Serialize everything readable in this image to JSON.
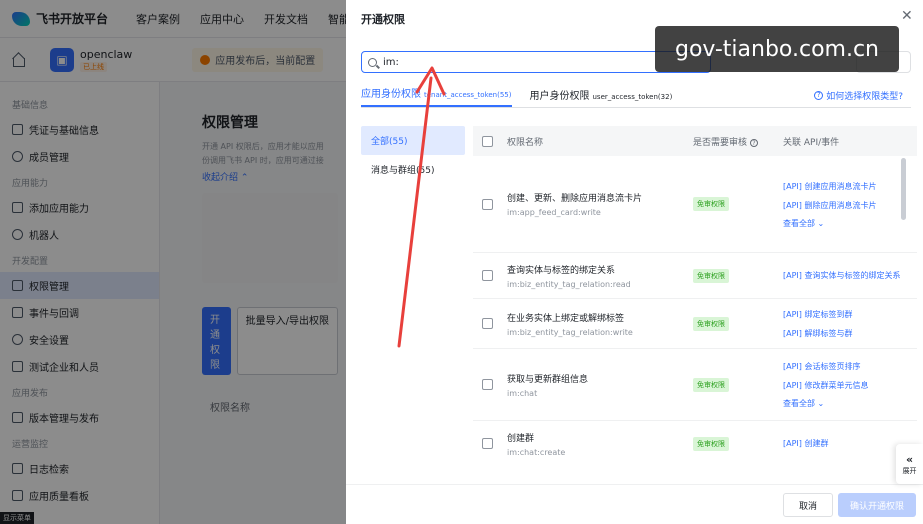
{
  "topnav": {
    "brand": "飞书开放平台",
    "links": [
      "客户案例",
      "应用中心",
      "开发文档",
      "智能助"
    ]
  },
  "subbar": {
    "app_icon": "cube-icon",
    "app_name": "openclaw",
    "app_tag": "已上线",
    "banner": "应用发布后，当前配置"
  },
  "sidebar": {
    "groups": [
      {
        "title": "基础信息",
        "items": [
          "凭证与基础信息",
          "成员管理"
        ]
      },
      {
        "title": "应用能力",
        "items": [
          "添加应用能力",
          "机器人"
        ]
      },
      {
        "title": "开发配置",
        "items": [
          "权限管理",
          "事件与回调",
          "安全设置",
          "测试企业和人员"
        ]
      },
      {
        "title": "应用发布",
        "items": [
          "版本管理与发布"
        ]
      },
      {
        "title": "运营监控",
        "items": [
          "日志检索",
          "应用质量看板"
        ]
      }
    ],
    "active_item": "权限管理",
    "menu_label": "显示菜单"
  },
  "main": {
    "title": "权限管理",
    "desc_1": "开通 API 权限后，应用才能以应用",
    "desc_2": "份调用飞书 API 时，应用可通过接",
    "collapse": "收起介绍",
    "btn_open": "开通权限",
    "btn_batch": "批量导入/导出权限",
    "table_header": "权限名称"
  },
  "drawer": {
    "title": "开通权限",
    "close_icon": "close-icon",
    "search_value": "im:",
    "tabs": [
      {
        "label": "应用身份权限",
        "sub": "tenant_access_token(55)"
      },
      {
        "label": "用户身份权限",
        "sub": "user_access_token(32)"
      }
    ],
    "help": "如何选择权限类型?",
    "categories": [
      "全部(55)",
      "消息与群组(55)"
    ],
    "columns": {
      "name": "权限名称",
      "review": "是否需要审核",
      "api": "关联 API/事件"
    },
    "rows": [
      {
        "name": "创建、更新、删除应用消息流卡片",
        "key": "im:app_feed_card:write",
        "badge": "免审权限",
        "apis": [
          "[API] 创建应用消息流卡片",
          "[API] 删除应用消息流卡片"
        ],
        "view_all": "查看全部"
      },
      {
        "name": "查询实体与标签的绑定关系",
        "key": "im:biz_entity_tag_relation:read",
        "badge": "免审权限",
        "apis": [
          "[API] 查询实体与标签的绑定关系"
        ],
        "view_all": ""
      },
      {
        "name": "在业务实体上绑定或解绑标签",
        "key": "im:biz_entity_tag_relation:write",
        "badge": "免审权限",
        "apis": [
          "[API] 绑定标签到群",
          "[API] 解绑标签与群"
        ],
        "view_all": ""
      },
      {
        "name": "获取与更新群组信息",
        "key": "im:chat",
        "badge": "免审权限",
        "apis": [
          "[API] 会话标签页排序",
          "[API] 修改群菜单元信息"
        ],
        "view_all": "查看全部"
      },
      {
        "name": "创建群",
        "key": "im:chat:create",
        "badge": "免审权限",
        "apis": [
          "[API] 创建群"
        ],
        "view_all": ""
      }
    ],
    "footer": {
      "cancel": "取消",
      "confirm": "确认开通权限"
    },
    "expand": "展开"
  },
  "watermark": "gov-tianbo.com.cn",
  "colors": {
    "primary": "#3370ff",
    "badge_bg": "#d9f5d6",
    "badge_text": "#2ea121",
    "arrow": "#e8403c"
  }
}
